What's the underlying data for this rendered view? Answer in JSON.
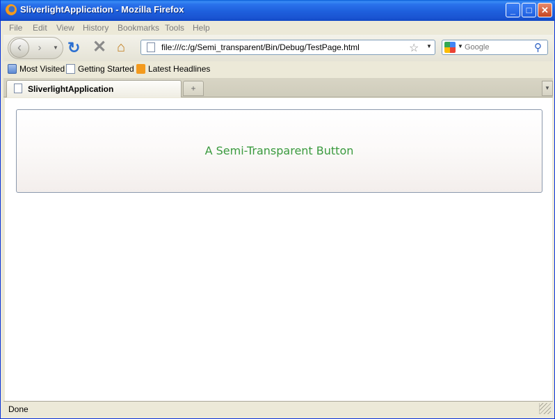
{
  "window": {
    "title": "SliverlightApplication - Mozilla Firefox",
    "controls": {
      "minimize": "_",
      "maximize": "□",
      "close": "✕"
    }
  },
  "menu": [
    "File",
    "Edit",
    "View",
    "History",
    "Bookmarks",
    "Tools",
    "Help"
  ],
  "navigation": {
    "back_icon": "back-arrow-icon",
    "forward_icon": "forward-arrow-icon",
    "url": "file:///c:/g/Semi_transparent/Bin/Debug/TestPage.html",
    "search_placeholder": "Google"
  },
  "bookmarks": [
    {
      "label": "Most Visited",
      "icon": "folder-icon"
    },
    {
      "label": "Getting Started",
      "icon": "page-icon"
    },
    {
      "label": "Latest Headlines",
      "icon": "rss-icon"
    }
  ],
  "tabs": [
    {
      "title": "SliverlightApplication",
      "active": true
    }
  ],
  "content": {
    "button_label": "A Semi-Transparent Button",
    "button_text_color": "#3a9a3e"
  },
  "status": {
    "text": "Done"
  },
  "colors": {
    "titlebar": "#1e5fdc",
    "chrome": "#ece9d8"
  }
}
